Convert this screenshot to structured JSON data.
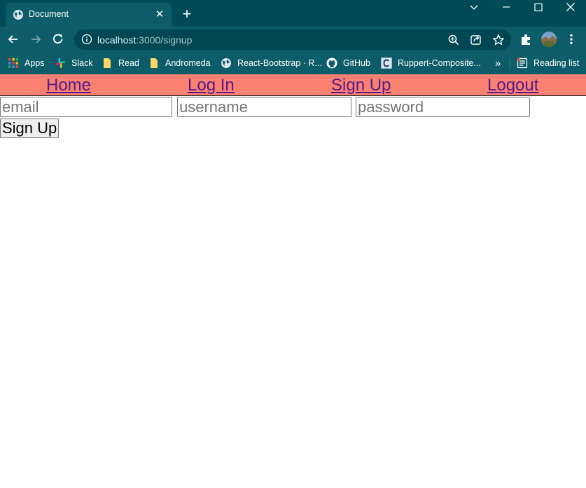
{
  "browser": {
    "tab": {
      "title": "Document",
      "close_glyph": "✕",
      "favicon": "globe-icon"
    },
    "new_tab_glyph": "+",
    "address": {
      "host": "localhost",
      "path": ":3000/signup"
    },
    "bookmarks": [
      {
        "label": "Apps",
        "icon": "apps-grid-icon"
      },
      {
        "label": "Slack",
        "icon": "slack-icon"
      },
      {
        "label": "Read",
        "icon": "folder-icon"
      },
      {
        "label": "Andromeda",
        "icon": "folder-icon"
      },
      {
        "label": "React-Bootstrap · R...",
        "icon": "globe-icon"
      },
      {
        "label": "GitHub",
        "icon": "github-icon"
      },
      {
        "label": "Ruppert-Composite...",
        "icon": "c-icon"
      }
    ],
    "overflow_glyph": "»",
    "reading_list": "Reading list",
    "colors": {
      "frame": "#004b57",
      "toolbar": "#0c5d69",
      "omnibox": "#004653"
    }
  },
  "nav": {
    "links": [
      "Home",
      "Log In",
      "Sign Up",
      "Logout"
    ],
    "background": "#fa8072",
    "link_color": "#551a8b"
  },
  "form": {
    "email_placeholder": "email",
    "username_placeholder": "username",
    "password_placeholder": "password",
    "submit_label": "Sign Up"
  }
}
